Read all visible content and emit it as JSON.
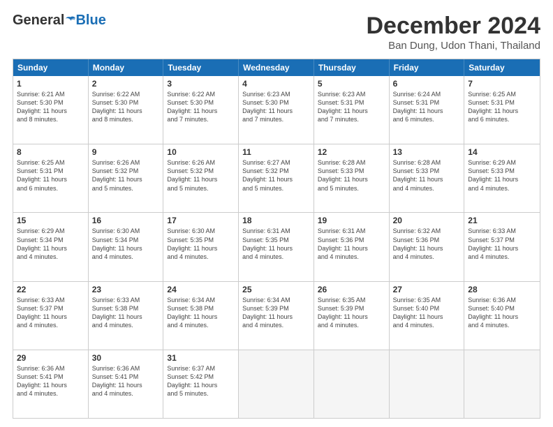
{
  "logo": {
    "general": "General",
    "blue": "Blue"
  },
  "title": "December 2024",
  "subtitle": "Ban Dung, Udon Thani, Thailand",
  "header_days": [
    "Sunday",
    "Monday",
    "Tuesday",
    "Wednesday",
    "Thursday",
    "Friday",
    "Saturday"
  ],
  "weeks": [
    [
      {
        "day": "1",
        "lines": [
          "Sunrise: 6:21 AM",
          "Sunset: 5:30 PM",
          "Daylight: 11 hours",
          "and 8 minutes."
        ]
      },
      {
        "day": "2",
        "lines": [
          "Sunrise: 6:22 AM",
          "Sunset: 5:30 PM",
          "Daylight: 11 hours",
          "and 8 minutes."
        ]
      },
      {
        "day": "3",
        "lines": [
          "Sunrise: 6:22 AM",
          "Sunset: 5:30 PM",
          "Daylight: 11 hours",
          "and 7 minutes."
        ]
      },
      {
        "day": "4",
        "lines": [
          "Sunrise: 6:23 AM",
          "Sunset: 5:30 PM",
          "Daylight: 11 hours",
          "and 7 minutes."
        ]
      },
      {
        "day": "5",
        "lines": [
          "Sunrise: 6:23 AM",
          "Sunset: 5:31 PM",
          "Daylight: 11 hours",
          "and 7 minutes."
        ]
      },
      {
        "day": "6",
        "lines": [
          "Sunrise: 6:24 AM",
          "Sunset: 5:31 PM",
          "Daylight: 11 hours",
          "and 6 minutes."
        ]
      },
      {
        "day": "7",
        "lines": [
          "Sunrise: 6:25 AM",
          "Sunset: 5:31 PM",
          "Daylight: 11 hours",
          "and 6 minutes."
        ]
      }
    ],
    [
      {
        "day": "8",
        "lines": [
          "Sunrise: 6:25 AM",
          "Sunset: 5:31 PM",
          "Daylight: 11 hours",
          "and 6 minutes."
        ]
      },
      {
        "day": "9",
        "lines": [
          "Sunrise: 6:26 AM",
          "Sunset: 5:32 PM",
          "Daylight: 11 hours",
          "and 5 minutes."
        ]
      },
      {
        "day": "10",
        "lines": [
          "Sunrise: 6:26 AM",
          "Sunset: 5:32 PM",
          "Daylight: 11 hours",
          "and 5 minutes."
        ]
      },
      {
        "day": "11",
        "lines": [
          "Sunrise: 6:27 AM",
          "Sunset: 5:32 PM",
          "Daylight: 11 hours",
          "and 5 minutes."
        ]
      },
      {
        "day": "12",
        "lines": [
          "Sunrise: 6:28 AM",
          "Sunset: 5:33 PM",
          "Daylight: 11 hours",
          "and 5 minutes."
        ]
      },
      {
        "day": "13",
        "lines": [
          "Sunrise: 6:28 AM",
          "Sunset: 5:33 PM",
          "Daylight: 11 hours",
          "and 4 minutes."
        ]
      },
      {
        "day": "14",
        "lines": [
          "Sunrise: 6:29 AM",
          "Sunset: 5:33 PM",
          "Daylight: 11 hours",
          "and 4 minutes."
        ]
      }
    ],
    [
      {
        "day": "15",
        "lines": [
          "Sunrise: 6:29 AM",
          "Sunset: 5:34 PM",
          "Daylight: 11 hours",
          "and 4 minutes."
        ]
      },
      {
        "day": "16",
        "lines": [
          "Sunrise: 6:30 AM",
          "Sunset: 5:34 PM",
          "Daylight: 11 hours",
          "and 4 minutes."
        ]
      },
      {
        "day": "17",
        "lines": [
          "Sunrise: 6:30 AM",
          "Sunset: 5:35 PM",
          "Daylight: 11 hours",
          "and 4 minutes."
        ]
      },
      {
        "day": "18",
        "lines": [
          "Sunrise: 6:31 AM",
          "Sunset: 5:35 PM",
          "Daylight: 11 hours",
          "and 4 minutes."
        ]
      },
      {
        "day": "19",
        "lines": [
          "Sunrise: 6:31 AM",
          "Sunset: 5:36 PM",
          "Daylight: 11 hours",
          "and 4 minutes."
        ]
      },
      {
        "day": "20",
        "lines": [
          "Sunrise: 6:32 AM",
          "Sunset: 5:36 PM",
          "Daylight: 11 hours",
          "and 4 minutes."
        ]
      },
      {
        "day": "21",
        "lines": [
          "Sunrise: 6:33 AM",
          "Sunset: 5:37 PM",
          "Daylight: 11 hours",
          "and 4 minutes."
        ]
      }
    ],
    [
      {
        "day": "22",
        "lines": [
          "Sunrise: 6:33 AM",
          "Sunset: 5:37 PM",
          "Daylight: 11 hours",
          "and 4 minutes."
        ]
      },
      {
        "day": "23",
        "lines": [
          "Sunrise: 6:33 AM",
          "Sunset: 5:38 PM",
          "Daylight: 11 hours",
          "and 4 minutes."
        ]
      },
      {
        "day": "24",
        "lines": [
          "Sunrise: 6:34 AM",
          "Sunset: 5:38 PM",
          "Daylight: 11 hours",
          "and 4 minutes."
        ]
      },
      {
        "day": "25",
        "lines": [
          "Sunrise: 6:34 AM",
          "Sunset: 5:39 PM",
          "Daylight: 11 hours",
          "and 4 minutes."
        ]
      },
      {
        "day": "26",
        "lines": [
          "Sunrise: 6:35 AM",
          "Sunset: 5:39 PM",
          "Daylight: 11 hours",
          "and 4 minutes."
        ]
      },
      {
        "day": "27",
        "lines": [
          "Sunrise: 6:35 AM",
          "Sunset: 5:40 PM",
          "Daylight: 11 hours",
          "and 4 minutes."
        ]
      },
      {
        "day": "28",
        "lines": [
          "Sunrise: 6:36 AM",
          "Sunset: 5:40 PM",
          "Daylight: 11 hours",
          "and 4 minutes."
        ]
      }
    ],
    [
      {
        "day": "29",
        "lines": [
          "Sunrise: 6:36 AM",
          "Sunset: 5:41 PM",
          "Daylight: 11 hours",
          "and 4 minutes."
        ]
      },
      {
        "day": "30",
        "lines": [
          "Sunrise: 6:36 AM",
          "Sunset: 5:41 PM",
          "Daylight: 11 hours",
          "and 4 minutes."
        ]
      },
      {
        "day": "31",
        "lines": [
          "Sunrise: 6:37 AM",
          "Sunset: 5:42 PM",
          "Daylight: 11 hours",
          "and 5 minutes."
        ]
      },
      {
        "day": "",
        "lines": []
      },
      {
        "day": "",
        "lines": []
      },
      {
        "day": "",
        "lines": []
      },
      {
        "day": "",
        "lines": []
      }
    ]
  ]
}
